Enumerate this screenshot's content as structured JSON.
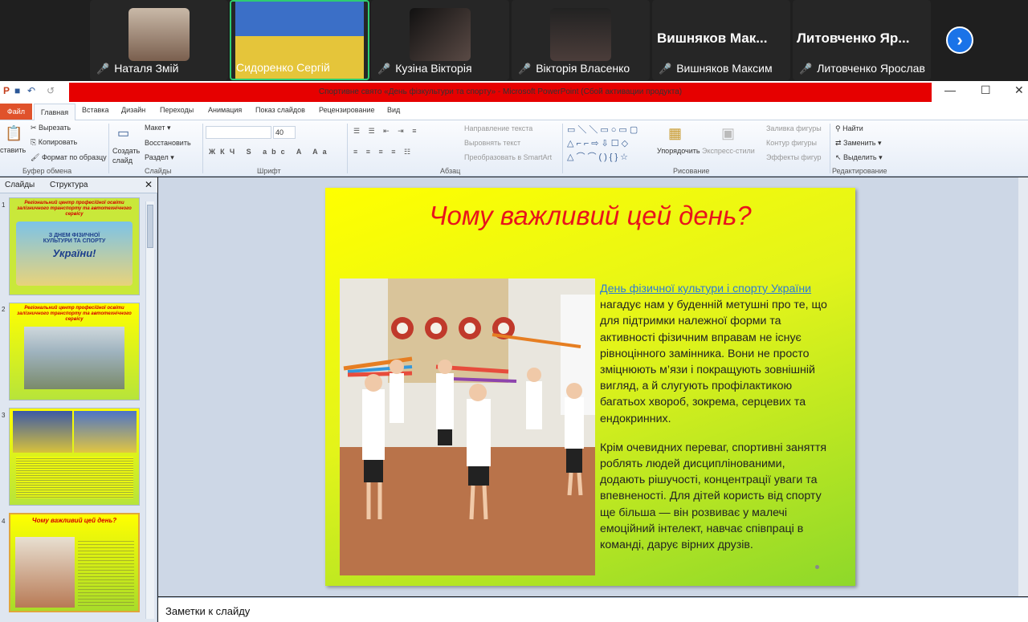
{
  "participants": [
    {
      "name": "Наталя Змій"
    },
    {
      "name": "Сидоренко Сергій"
    },
    {
      "name": "Кузіна Вікторія"
    },
    {
      "name": "Вікторія Власенко"
    },
    {
      "name": "Вишняков Максим",
      "display": "Вишняков Мак..."
    },
    {
      "name": "Литовченко Ярослав",
      "display": "Литовченко Яр..."
    }
  ],
  "window_title": "Спортивне свято «День фізкультури та спорту» - Microsoft PowerPoint (Сбой активации продукта)",
  "ribbon_tabs": [
    "Файл",
    "Главная",
    "Вставка",
    "Дизайн",
    "Переходы",
    "Анимация",
    "Показ слайдов",
    "Рецензирование",
    "Вид"
  ],
  "ribbon": {
    "paste": "ставить",
    "cut": "Вырезать",
    "copy": "Копировать",
    "format_painter": "Формат по образцу",
    "clipboard_group": "Буфер обмена",
    "new_slide": "Создать слайд",
    "layout": "Макет",
    "reset": "Восстановить",
    "section": "Раздел",
    "slides_group": "Слайды",
    "font_size": "40",
    "font_group": "Шрифт",
    "text_direction": "Направление текста",
    "align_text": "Выровнять текст",
    "convert_smartart": "Преобразовать в SmartArt",
    "paragraph_group": "Абзац",
    "arrange": "Упорядочить",
    "quick_styles": "Экспресс-стили",
    "shape_fill": "Заливка фигуры",
    "shape_outline": "Контур фигуры",
    "shape_effects": "Эффекты фигур",
    "drawing_group": "Рисование",
    "find": "Найти",
    "replace": "Заменить",
    "select": "Выделить",
    "editing_group": "Редактирование"
  },
  "left_pane": {
    "tab_slides": "Слайды",
    "tab_outline": "Структура",
    "thumbnails": [
      {
        "num": "1",
        "title": "Регіональний центр професійної освіти залізничного транспорту та автотехнічного сервісу",
        "banner": "З ДНЕМ ФІЗИЧНОЇ КУЛЬТУРИ ТА СПОРТУ",
        "banner2": "України!"
      },
      {
        "num": "2",
        "title": "Регіональний центр професійної освіти залізничного транспорту та автотехнічного сервісу"
      },
      {
        "num": "3"
      },
      {
        "num": "4",
        "title": "Чому важливий цей день?"
      }
    ]
  },
  "slide": {
    "title": "Чому важливий цей день?",
    "link_text": "День фізичної культури і спорту України",
    "paragraph1_rest": " нагадує нам у буденній метушні про те, що для підтримки належної форми та активності фізичним вправам не існує рівноцінного замінника.  Вони не просто зміцнюють м’язи і покращують зовнішній вигляд, а й слугують профілактикою багатьох хвороб, зокрема, серцевих та ендокринних.",
    "paragraph2": "Крім очевидних переваг, спортивні заняття роблять людей дисциплінованими, додають рішучості, концентрації уваги та впевненості. Для дітей користь від спорту ще більша — він розвиває у малечі емоційний інтелект, навчає співпраці в команді, дарує вірних друзів."
  },
  "notes_placeholder": "Заметки к слайду",
  "colors": {
    "title_red": "#e8141c",
    "titlebar_red": "#e60000",
    "link_blue": "#2e7bd6",
    "zoom_blue": "#1a73e8"
  }
}
